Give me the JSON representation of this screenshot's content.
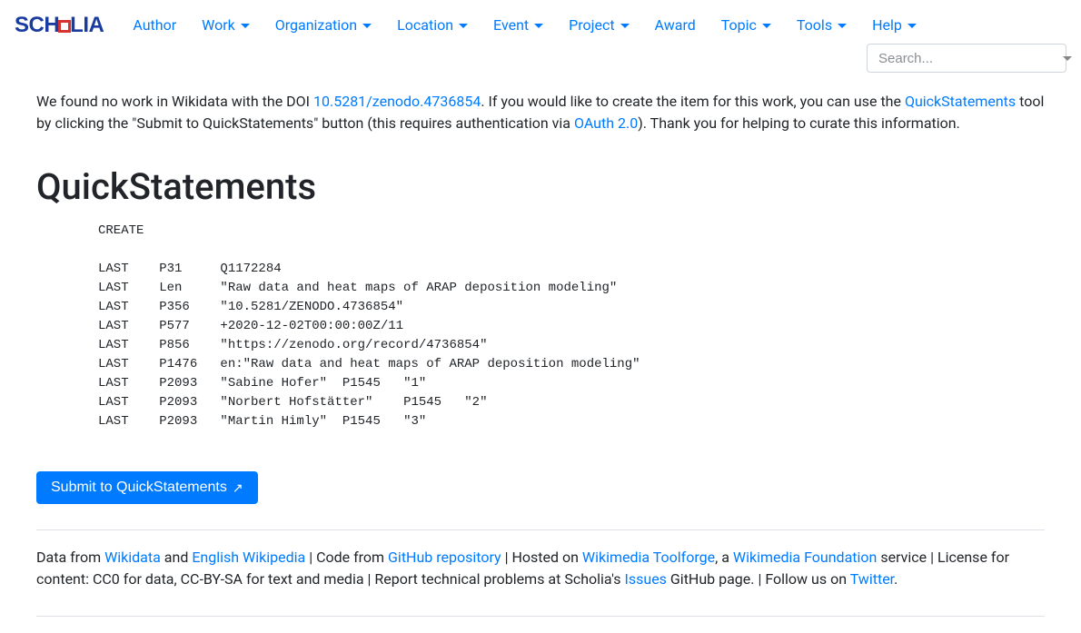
{
  "brand": {
    "name": "SCHOLIA"
  },
  "nav": {
    "items": [
      {
        "label": "Author",
        "dropdown": false
      },
      {
        "label": "Work",
        "dropdown": true
      },
      {
        "label": "Organization",
        "dropdown": true
      },
      {
        "label": "Location",
        "dropdown": true
      },
      {
        "label": "Event",
        "dropdown": true
      },
      {
        "label": "Project",
        "dropdown": true
      },
      {
        "label": "Award",
        "dropdown": false
      },
      {
        "label": "Topic",
        "dropdown": true
      },
      {
        "label": "Tools",
        "dropdown": true
      },
      {
        "label": "Help",
        "dropdown": true
      }
    ],
    "search_placeholder": "Search..."
  },
  "intro": {
    "t1": "We found no work in Wikidata with the DOI ",
    "doi": "10.5281/zenodo.4736854",
    "t2": ". If you would like to create the item for this work, you can use the ",
    "qs_link": "QuickStatements",
    "t3": " tool by clicking the \"Submit to QuickStatements\" button (this requires authentication via ",
    "oauth": "OAuth 2.0",
    "t4": "). Thank you for helping to curate this information."
  },
  "heading": "QuickStatements",
  "quickstatements": "CREATE\n\nLAST\tP31\tQ1172284\nLAST\tLen\t\"Raw data and heat maps of ARAP deposition modeling\"\nLAST\tP356\t\"10.5281/ZENODO.4736854\"\nLAST\tP577\t+2020-12-02T00:00:00Z/11\nLAST\tP856\t\"https://zenodo.org/record/4736854\"\nLAST\tP1476\ten:\"Raw data and heat maps of ARAP deposition modeling\"\nLAST\tP2093\t\"Sabine Hofer\"\tP1545\t\"1\"\nLAST\tP2093\t\"Norbert Hofstätter\"\tP1545\t\"2\"\nLAST\tP2093\t\"Martin Himly\"\tP1545\t\"3\"",
  "submit_label": "Submit to QuickStatements ",
  "footer": {
    "f1": "Data from ",
    "wikidata": "Wikidata",
    "f2": " and ",
    "enwiki": "English Wikipedia",
    "f3": " | Code from ",
    "github": "GitHub repository",
    "f4": " | Hosted on ",
    "toolforge": "Wikimedia Toolforge",
    "f5": ", a ",
    "wmf": "Wikimedia Foundation",
    "f6": " service | License for content: CC0 for data, CC-BY-SA for text and media | Report technical problems at Scholia's ",
    "issues": "Issues",
    "f7": " GitHub page. | Follow us on ",
    "twitter": "Twitter",
    "f8": "."
  }
}
